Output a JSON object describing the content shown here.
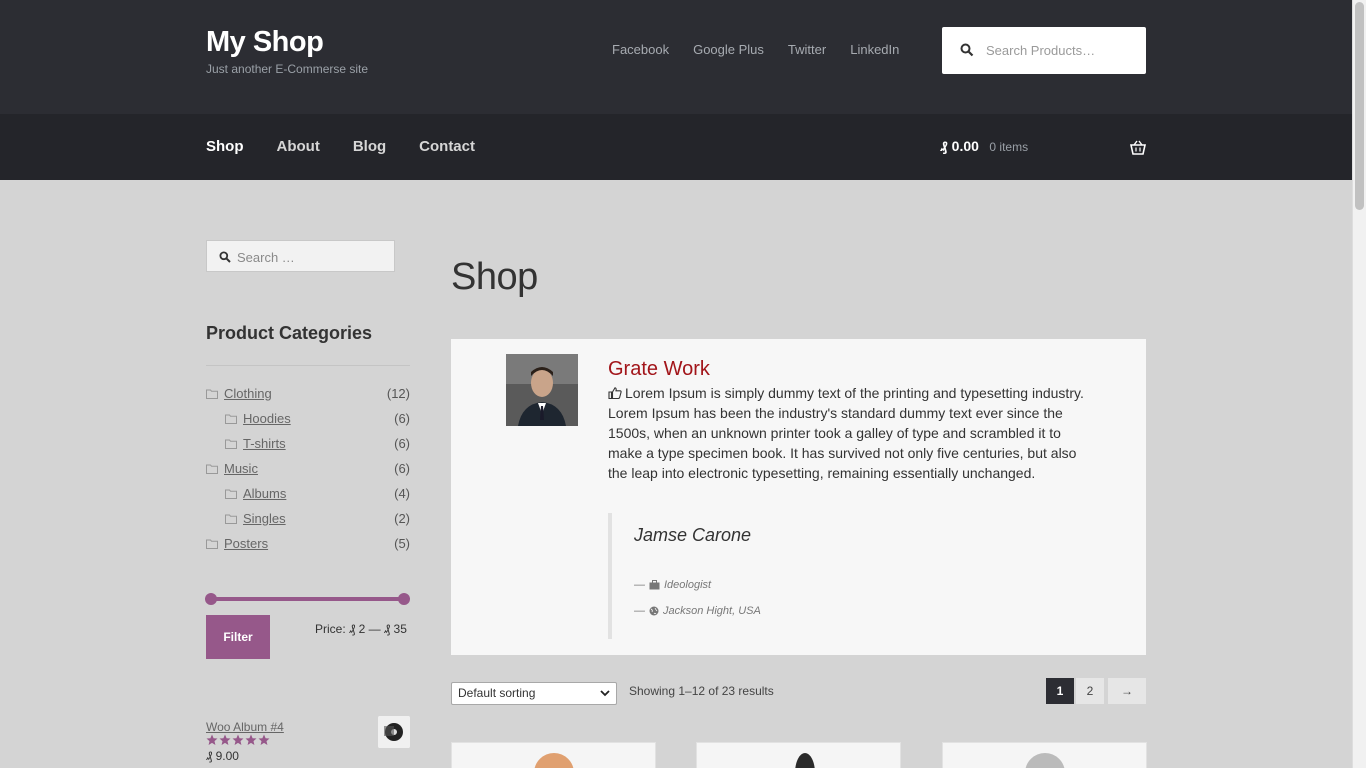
{
  "header": {
    "site_title": "My Shop",
    "tagline": "Just another E-Commerse site",
    "social_links": [
      "Facebook",
      "Google Plus",
      "Twitter",
      "LinkedIn"
    ],
    "search_placeholder": "Search Products…"
  },
  "nav": {
    "items": [
      "Shop",
      "About",
      "Blog",
      "Contact"
    ],
    "active": "Shop"
  },
  "cart": {
    "amount": "₰ 0.00",
    "count": "0 items"
  },
  "sidebar": {
    "search_placeholder": "Search …",
    "categories_title": "Product Categories",
    "categories": [
      {
        "label": "Clothing",
        "count": "(12)"
      },
      {
        "label": "Hoodies",
        "count": "(6)"
      },
      {
        "label": "T-shirts",
        "count": "(6)"
      },
      {
        "label": "Music",
        "count": "(6)"
      },
      {
        "label": "Albums",
        "count": "(4)"
      },
      {
        "label": "Singles",
        "count": "(2)"
      },
      {
        "label": "Posters",
        "count": "(5)"
      }
    ],
    "filter_label": "Filter",
    "price_label": "Price: ₰ 2 — ₰ 35",
    "product": {
      "name": "Woo Album #4",
      "rating": 5,
      "price": "₰ 9.00"
    }
  },
  "main": {
    "page_title": "Shop",
    "testimonial": {
      "title": "Grate Work",
      "text": "Lorem Ipsum is simply dummy text of the printing and typesetting industry. Lorem Ipsum has been the industry's standard dummy text ever since the 1500s, when an unknown printer took a galley of type and scrambled it to make a type specimen book. It has survived not only five centuries, but also the leap into electronic typesetting, remaining essentially unchanged.",
      "author": "Jamse Carone",
      "role": "Ideologist",
      "location": "Jackson Hight, USA"
    },
    "sorting": "Default sorting",
    "results": "Showing 1–12 of 23 results",
    "pagination": {
      "current": "1",
      "next_page": "2",
      "next_arrow": "→"
    }
  },
  "colors": {
    "header_bg": "#2c2d33",
    "nav_bg": "#24252a",
    "accent": "#96588a",
    "testimonial_title": "#a2151a",
    "page_bg": "#d4d4d4"
  }
}
